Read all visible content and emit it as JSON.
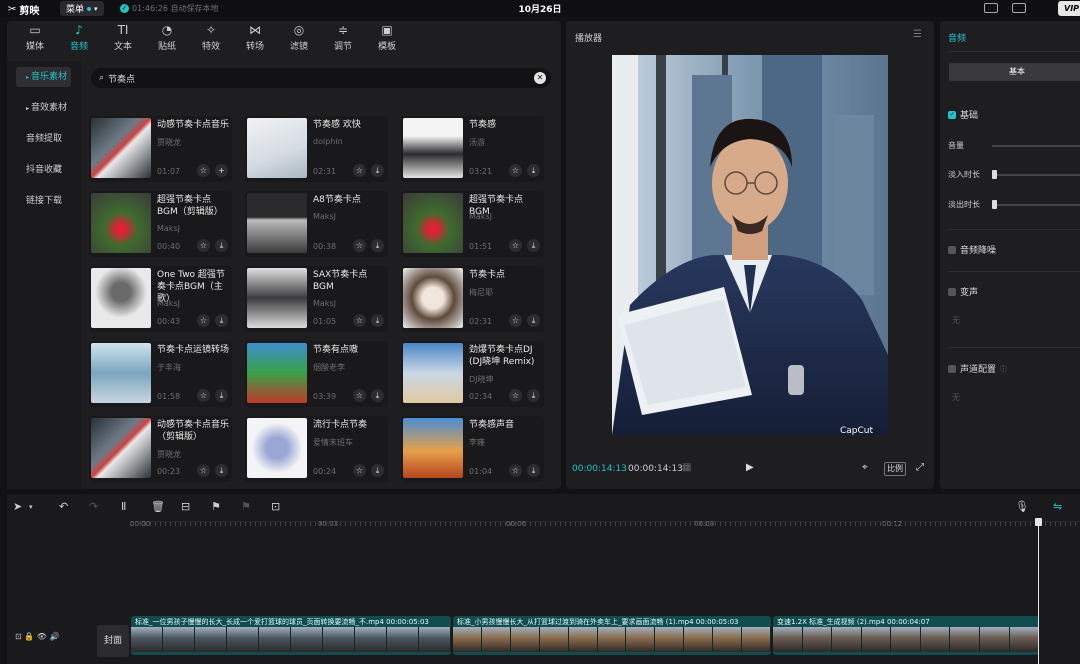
{
  "topbar": {
    "app_name": "剪映",
    "menu_label": "菜单",
    "autosave_text": "01:46:26 自动保存本地",
    "date": "10月26日"
  },
  "tabs": [
    {
      "label": "媒体",
      "icon": "media-icon"
    },
    {
      "label": "音频",
      "icon": "audio-icon",
      "active": true
    },
    {
      "label": "文本",
      "icon": "text-icon"
    },
    {
      "label": "贴纸",
      "icon": "sticker-icon"
    },
    {
      "label": "特效",
      "icon": "effects-icon"
    },
    {
      "label": "转场",
      "icon": "transition-icon"
    },
    {
      "label": "滤镜",
      "icon": "filter-icon"
    },
    {
      "label": "调节",
      "icon": "adjust-icon"
    },
    {
      "label": "模板",
      "icon": "template-icon"
    }
  ],
  "sidebar": [
    {
      "label": "音乐素材",
      "active": true,
      "arrow": true
    },
    {
      "label": "音效素材",
      "active": false,
      "arrow": true
    },
    {
      "label": "音频提取",
      "active": false,
      "arrow": false
    },
    {
      "label": "抖音收藏",
      "active": false,
      "arrow": false
    },
    {
      "label": "链接下载",
      "active": false,
      "arrow": false
    }
  ],
  "search": {
    "value": "节奏点"
  },
  "music": [
    {
      "title": "动感节奏卡点音乐",
      "author": "贾晓龙",
      "duration": "01:07",
      "second_icon": "add-icon"
    },
    {
      "title": "节奏感 欢快",
      "author": "dolphin",
      "duration": "02:31",
      "second_icon": "download-icon"
    },
    {
      "title": "节奏感",
      "author": "汤游",
      "duration": "03:21",
      "second_icon": "download-icon"
    },
    {
      "title": "超强节奏卡点BGM（剪辑版）",
      "author": "MaksJ",
      "duration": "00:40",
      "second_icon": "download-icon"
    },
    {
      "title": "A8节奏卡点",
      "author": "MaksJ",
      "duration": "00:38",
      "second_icon": "download-icon"
    },
    {
      "title": "超强节奏卡点BGM",
      "author": "MaksJ",
      "duration": "01:51",
      "second_icon": "download-icon"
    },
    {
      "title": "One Two 超强节奏卡点BGM（主歌）",
      "author": "MaksJ",
      "duration": "00:43",
      "second_icon": "download-icon"
    },
    {
      "title": "SAX节奏卡点BGM",
      "author": "MaksJ",
      "duration": "01:05",
      "second_icon": "download-icon"
    },
    {
      "title": "节奏卡点",
      "author": "梅尼耶",
      "duration": "02:31",
      "second_icon": "download-icon"
    },
    {
      "title": "节奏卡点运镜转场",
      "author": "于丰海",
      "duration": "01:58",
      "second_icon": "download-icon"
    },
    {
      "title": "节奏有点嗷",
      "author": "烟酸老李",
      "duration": "03:39",
      "second_icon": "download-icon"
    },
    {
      "title": "劲爆节奏卡点DJ (DJ晓坤 Remix)",
      "author": "DJ晓坤",
      "duration": "02:34",
      "second_icon": "download-icon"
    },
    {
      "title": "动感节奏卡点音乐（剪辑版）",
      "author": "贾晓龙",
      "duration": "00:23",
      "second_icon": "download-icon"
    },
    {
      "title": "流行卡点节奏",
      "author": "爱情末班车",
      "duration": "00:24",
      "second_icon": "download-icon"
    },
    {
      "title": "节奏感声音",
      "author": "李雍",
      "duration": "01:04",
      "second_icon": "download-icon"
    }
  ],
  "player": {
    "title": "播放器",
    "current_time": "00:00:14:13",
    "total_time": "00:00:14:13",
    "ratio_label": "比例",
    "watermark": "CapCut"
  },
  "props": {
    "tab_label": "音频",
    "basic_button": "基本",
    "section_basic": "基础",
    "volume_label": "音量",
    "fade_in_label": "淡入时长",
    "fade_out_label": "淡出时长",
    "denoise_label": "音频降噪",
    "voice_change_label": "变声",
    "voice_change_value": "无",
    "channel_label": "声道配置",
    "channel_value": "无"
  },
  "timeline": {
    "ruler": [
      "00:00",
      "00:03",
      "00:06",
      "00:09",
      "00:12"
    ],
    "cover_label": "封面",
    "clips": [
      {
        "label": "标准_一位男孩子慢慢的长大_长成一个爱打篮球的球员_页面转换要流畅_不.mp4  00:00:05:03",
        "frames": 10,
        "tone": "#4a5560"
      },
      {
        "label": "标准_小男孩慢慢长大_从打篮球过渡到骑在外卖车上_要求画面流畅 (1).mp4  00:00:05:03",
        "frames": 11,
        "tone": "#8a6a4a"
      },
      {
        "label": "变速1.2X  标准_生成视频 (2).mp4  00:00:04:07",
        "frames": 9,
        "tone": "#6a5a50"
      }
    ]
  },
  "colors": {
    "accent": "#22c3c9",
    "panel": "#1e1e21",
    "bg": "#121214"
  }
}
